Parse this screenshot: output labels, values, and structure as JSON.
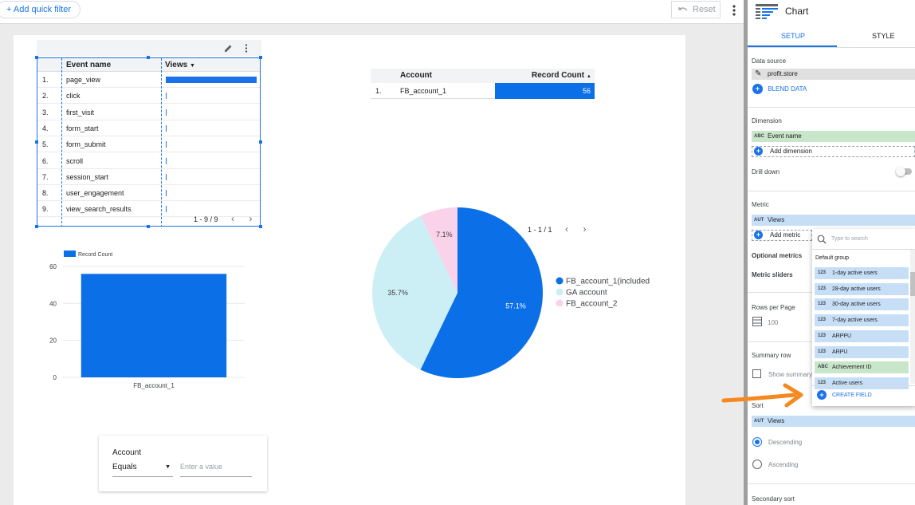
{
  "topbar": {
    "quick_filter": "+ Add quick filter",
    "reset": "Reset"
  },
  "event_table": {
    "columns": [
      "Event name",
      "Views"
    ],
    "sort_icon": "caret-down-icon",
    "rows": [
      {
        "num": "1.",
        "name": "page_view",
        "views": 1.0
      },
      {
        "num": "2.",
        "name": "click",
        "views": 0.0
      },
      {
        "num": "3.",
        "name": "first_visit",
        "views": 0.0
      },
      {
        "num": "4.",
        "name": "form_start",
        "views": 0.0
      },
      {
        "num": "5.",
        "name": "form_submit",
        "views": 0.0
      },
      {
        "num": "6.",
        "name": "scroll",
        "views": 0.0
      },
      {
        "num": "7.",
        "name": "session_start",
        "views": 0.0
      },
      {
        "num": "8.",
        "name": "user_engagement",
        "views": 0.0
      },
      {
        "num": "9.",
        "name": "view_search_results",
        "views": 0.0
      }
    ],
    "pager": "1 - 9 / 9"
  },
  "account_table": {
    "columns": [
      "Account",
      "Record Count"
    ],
    "rows": [
      {
        "num": "1.",
        "account": "FB_account_1",
        "count": "56"
      }
    ]
  },
  "pie_pager": "1 - 1 / 1",
  "filter_control": {
    "label": "Account",
    "operator": "Equals",
    "placeholder": "Enter a value"
  },
  "chart_data": [
    {
      "type": "bar",
      "legend": [
        "Record Count"
      ],
      "categories": [
        "FB_account_1"
      ],
      "values": [
        56
      ],
      "ylim": [
        0,
        60
      ],
      "yticks": [
        "0",
        "20",
        "40",
        "60"
      ],
      "color": "#0b6fe8"
    },
    {
      "type": "pie",
      "labels": [
        "FB_account_1(included)",
        "GA account",
        "FB_account_2"
      ],
      "values": [
        57.1,
        35.7,
        7.1
      ],
      "value_labels": [
        "57.1%",
        "35.7%",
        "7.1%"
      ],
      "colors": [
        "#0b6fe8",
        "#cceff6",
        "#fad3ea"
      ],
      "legend_position": "right"
    }
  ],
  "panel": {
    "title": "Chart",
    "tabs": [
      "SETUP",
      "STYLE"
    ],
    "data_source_label": "Data source",
    "data_source": "profit.store",
    "blend_data": "BLEND DATA",
    "dimension_label": "Dimension",
    "dimension": {
      "tag": "ABC",
      "name": "Event name"
    },
    "add_dimension": "Add dimension",
    "drill_down": "Drill down",
    "metric_label": "Metric",
    "metric": {
      "tag": "AUT",
      "name": "Views"
    },
    "add_metric": "Add metric",
    "optional_metrics": "Optional metrics",
    "metric_sliders": "Metric sliders",
    "rows_per_page_label": "Rows per Page",
    "rows_per_page": "100",
    "summary_row_label": "Summary row",
    "show_summary": "Show summary",
    "sort_label": "Sort",
    "sort_field": {
      "tag": "AUT",
      "name": "Views"
    },
    "descending": "Descending",
    "ascending": "Ascending",
    "secondary_sort": "Secondary sort"
  },
  "field_dropdown": {
    "search_placeholder": "Type to search",
    "group": "Default group",
    "items": [
      {
        "tag": "123",
        "name": "1-day active users",
        "kind": "metric"
      },
      {
        "tag": "123",
        "name": "28-day active users",
        "kind": "metric"
      },
      {
        "tag": "123",
        "name": "30-day active users",
        "kind": "metric"
      },
      {
        "tag": "123",
        "name": "7-day active users",
        "kind": "metric"
      },
      {
        "tag": "123",
        "name": "ARPPU",
        "kind": "metric"
      },
      {
        "tag": "123",
        "name": "ARPU",
        "kind": "metric"
      },
      {
        "tag": "ABC",
        "name": "Achievement ID",
        "kind": "dimension"
      },
      {
        "tag": "123",
        "name": "Active users",
        "kind": "metric"
      }
    ],
    "create_field": "CREATE FIELD"
  }
}
